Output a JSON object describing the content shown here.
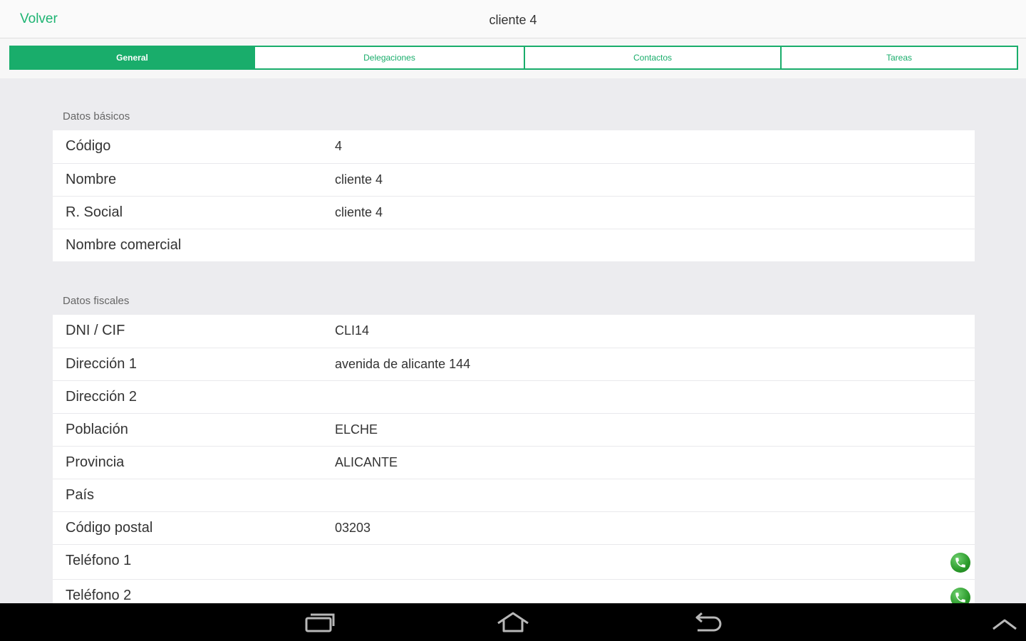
{
  "header": {
    "back_label": "Volver",
    "title": "cliente 4"
  },
  "tabs": [
    {
      "label": "General",
      "active": true
    },
    {
      "label": "Delegaciones",
      "active": false
    },
    {
      "label": "Contactos",
      "active": false
    },
    {
      "label": "Tareas",
      "active": false
    }
  ],
  "sections": {
    "basicos": {
      "label": "Datos básicos",
      "rows": [
        {
          "key": "Código",
          "value": "4"
        },
        {
          "key": "Nombre",
          "value": "cliente 4"
        },
        {
          "key": "R. Social",
          "value": "cliente 4"
        },
        {
          "key": "Nombre comercial",
          "value": ""
        }
      ]
    },
    "fiscales": {
      "label": "Datos fiscales",
      "rows": [
        {
          "key": "DNI / CIF",
          "value": "CLI14"
        },
        {
          "key": "Dirección 1",
          "value": "avenida de alicante 144"
        },
        {
          "key": "Dirección 2",
          "value": ""
        },
        {
          "key": "Población",
          "value": "ELCHE"
        },
        {
          "key": "Provincia",
          "value": "ALICANTE"
        },
        {
          "key": "País",
          "value": ""
        },
        {
          "key": "Código postal",
          "value": "03203"
        },
        {
          "key": "Teléfono 1",
          "value": ""
        },
        {
          "key": "Teléfono 2",
          "value": ""
        }
      ]
    }
  },
  "icons": {
    "phone": "phone-icon",
    "recent_apps": "recent-apps-icon",
    "home": "home-icon",
    "back": "back-icon",
    "menu_up": "chevron-up-icon"
  },
  "colors": {
    "accent": "#19ad6b",
    "back_link": "#1db472",
    "phone_green": "#2a9a2a"
  }
}
